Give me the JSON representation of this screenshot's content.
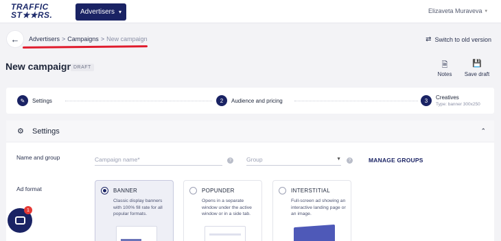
{
  "header": {
    "logo_line1": "TRAFFIC",
    "logo_line2": "ST★★RS.",
    "advertisers_label": "Advertisers",
    "user_name": "Elizaveta Muraveva"
  },
  "breadcrumb": {
    "items": [
      "Advertisers",
      "Campaigns",
      "New campaign"
    ],
    "separator": ">"
  },
  "switch_old": "Switch to old version",
  "page": {
    "title": "New campaign",
    "badge": "DRAFT"
  },
  "actions": {
    "notes": "Notes",
    "save_draft": "Save draft"
  },
  "stepper": {
    "steps": [
      {
        "number": "1",
        "label": "Settings",
        "sub": ""
      },
      {
        "number": "2",
        "label": "Audience and pricing",
        "sub": ""
      },
      {
        "number": "3",
        "label": "Creatives",
        "sub": "Type: banner 300x250"
      }
    ]
  },
  "settings": {
    "title": "Settings",
    "name_and_group_label": "Name and group",
    "campaign_name_placeholder": "Campaign name*",
    "group_placeholder": "Group",
    "help_glyph": "?",
    "manage_groups": "MANAGE GROUPS",
    "ad_format_label": "Ad format",
    "formats": [
      {
        "title": "BANNER",
        "desc": "Classic display banners with 100% fill rate for all popular formats.",
        "selected": true
      },
      {
        "title": "POPUNDER",
        "desc": "Opens in a separate window under the active window or in a side tab.",
        "selected": false
      },
      {
        "title": "INTERSTITIAL",
        "desc": "Full-screen ad showing an interactive landing page or an image.",
        "selected": false
      }
    ]
  },
  "chat": {
    "badge_count": "1"
  },
  "icons": {
    "back": "arrow-left-icon",
    "switch": "switch-icon",
    "notes": "notes-icon",
    "save": "floppy-disk-icon",
    "edit": "pencil-icon",
    "gear": "gear-icon",
    "collapse": "chevron-up-icon",
    "chat": "chat-icon"
  },
  "colors": {
    "brand_navy": "#1a2364",
    "annotation_red": "#e01b2c",
    "chat_badge": "#e53935"
  }
}
